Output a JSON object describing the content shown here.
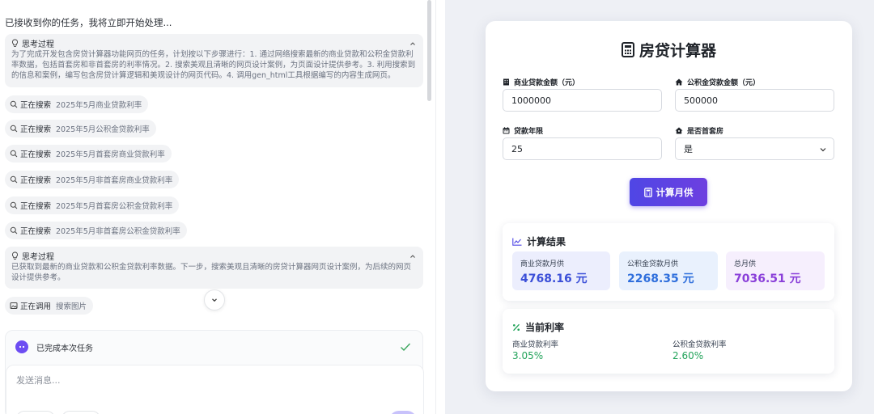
{
  "chat": {
    "intro": "已接收到你的任务，我将立即开始处理...",
    "thinking": [
      {
        "title": "思考过程",
        "body": "为了完成开发包含房贷计算器功能网页的任务，计划按以下步骤进行：1. 通过网络搜索最新的商业贷款和公积金贷款利率数据，包括首套房和非首套房的利率情况。2. 搜索美观且清晰的网页设计案例，为页面设计提供参考。3. 利用搜索到的信息和案例，编写包含房贷计算逻辑和美观设计的网页代码。4. 调用gen_html工具根据编写的内容生成网页。"
      },
      {
        "title": "思考过程",
        "body": "已获取到最新的商业贷款和公积金贷款利率数据。下一步，搜索美观且清晰的房贷计算器网页设计案例，为后续的网页设计提供参考。"
      }
    ],
    "search_label": "正在搜索",
    "searches": [
      "2025年5月商业贷款利率",
      "2025年5月公积金贷款利率",
      "2025年5月首套房商业贷款利率",
      "2025年5月非首套房商业贷款利率",
      "2025年5月首套房公积金贷款利率",
      "2025年5月非首套房公积金贷款利率"
    ],
    "tool_call": {
      "label": "正在调用",
      "name": "搜索图片"
    },
    "done_text": "已完成本次任务",
    "input_placeholder": "发送消息..."
  },
  "calculator": {
    "title": "房贷计算器",
    "fields": {
      "commercial_amount": {
        "label": "商业贷款金额（元）",
        "value": "1000000"
      },
      "fund_amount": {
        "label": "公积金贷款金额（元）",
        "value": "500000"
      },
      "years": {
        "label": "贷款年限",
        "value": "25"
      },
      "first_home": {
        "label": "是否首套房",
        "value": "是"
      }
    },
    "button": "计算月供",
    "results": {
      "title": "计算结果",
      "commercial": {
        "label": "商业贷款月供",
        "value": "4768.16 元"
      },
      "fund": {
        "label": "公积金贷款月供",
        "value": "2268.35 元"
      },
      "total": {
        "label": "总月供",
        "value": "7036.51 元"
      }
    },
    "rates": {
      "title": "当前利率",
      "commercial": {
        "label": "商业贷款利率",
        "value": "3.05%"
      },
      "fund": {
        "label": "公积金贷款利率",
        "value": "2.60%"
      }
    }
  },
  "colors": {
    "accent": "#5b45e6",
    "result_commercial": "#3b4fd8",
    "result_total": "#8a3fd9",
    "rate_green": "#22a35a"
  }
}
